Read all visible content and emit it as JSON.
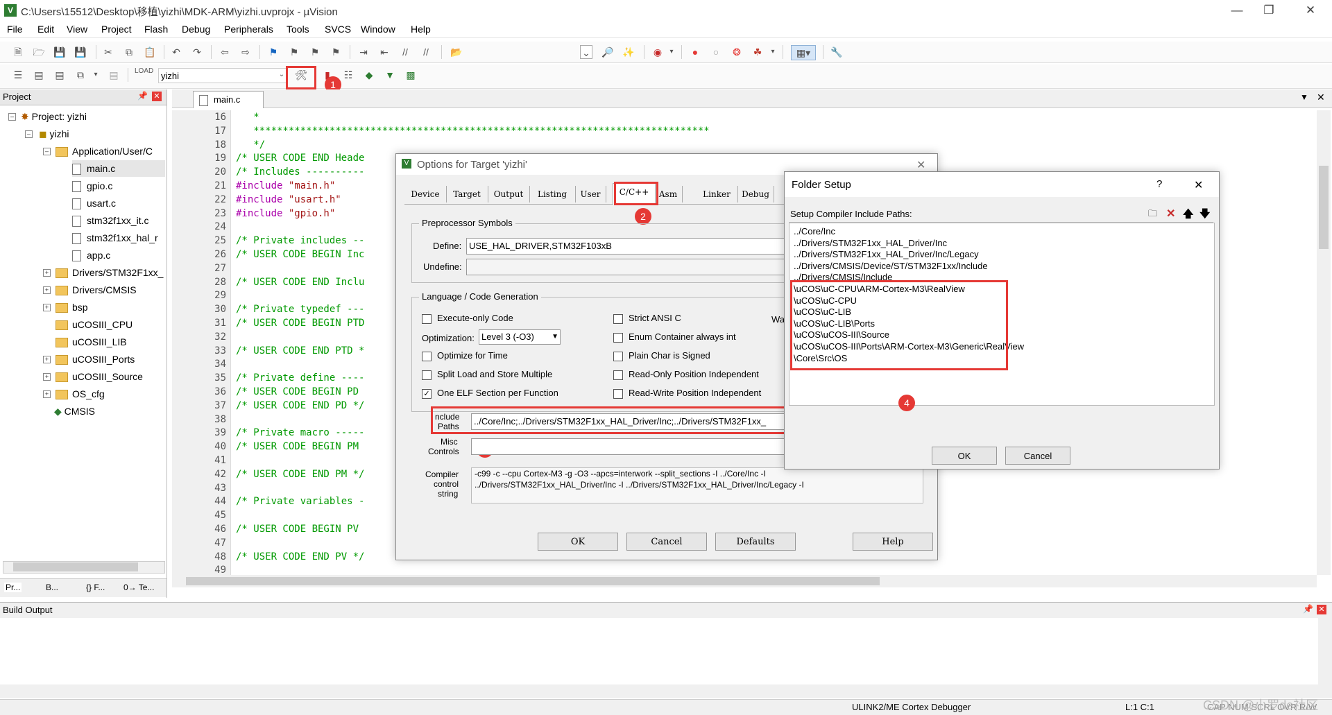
{
  "window": {
    "title": "C:\\Users\\15512\\Desktop\\移植\\yizhi\\MDK-ARM\\yizhi.uvprojx - µVision"
  },
  "menu": [
    "File",
    "Edit",
    "View",
    "Project",
    "Flash",
    "Debug",
    "Peripherals",
    "Tools",
    "SVCS",
    "Window",
    "Help"
  ],
  "toolbar2": {
    "target_select": "yizhi"
  },
  "badges": [
    "1",
    "2",
    "3",
    "4"
  ],
  "project": {
    "header": "Project",
    "root": "Project: yizhi",
    "target": "yizhi",
    "group_app": "Application/User/C",
    "files": [
      "main.c",
      "gpio.c",
      "usart.c",
      "stm32f1xx_it.c",
      "stm32f1xx_hal_r",
      "app.c"
    ],
    "groups": [
      "Drivers/STM32F1xx_",
      "Drivers/CMSIS",
      "bsp",
      "uCOSIII_CPU",
      "uCOSIII_LIB",
      "uCOSIII_Ports",
      "uCOSIII_Source",
      "OS_cfg"
    ],
    "cmsis": "CMSIS",
    "bottom_tabs": [
      "Pr...",
      "B...",
      "{} F...",
      "0→ Te..."
    ]
  },
  "editor": {
    "tab": "main.c",
    "line_numbers": [
      "16",
      "17",
      "18",
      "19",
      "20",
      "21",
      "22",
      "23",
      "24",
      "25",
      "26",
      "27",
      "28",
      "29",
      "30",
      "31",
      "32",
      "33",
      "34",
      "35",
      "36",
      "37",
      "38",
      "39",
      "40",
      "41",
      "42",
      "43",
      "44",
      "45",
      "46",
      "47",
      "48",
      "49"
    ],
    "lines": [
      "   *",
      "   ******************************************************************************",
      "   */",
      "/* USER CODE END Heade",
      "/* Includes ----------",
      "#include \"main.h\"",
      "#include \"usart.h\"",
      "#include \"gpio.h\"",
      "",
      "/* Private includes --",
      "/* USER CODE BEGIN Inc",
      "",
      "/* USER CODE END Inclu",
      "",
      "/* Private typedef ---",
      "/* USER CODE BEGIN PTD",
      "",
      "/* USER CODE END PTD *",
      "",
      "/* Private define ----",
      "/* USER CODE BEGIN PD",
      "/* USER CODE END PD */",
      "",
      "/* Private macro -----",
      "/* USER CODE BEGIN PM",
      "",
      "/* USER CODE END PM */",
      "",
      "/* Private variables -",
      "",
      "/* USER CODE BEGIN PV",
      "",
      "/* USER CODE END PV */",
      ""
    ]
  },
  "options_dialog": {
    "title": "Options for Target 'yizhi'",
    "tabs": [
      "Device",
      "Target",
      "Output",
      "Listing",
      "User",
      "C/C++",
      "Asm",
      "Linker",
      "Debug"
    ],
    "preproc_group": "Preprocessor Symbols",
    "define_label": "Define:",
    "define_value": "USE_HAL_DRIVER,STM32F103xB",
    "undefine_label": "Undefine:",
    "lang_group": "Language / Code Generation",
    "execute_only": "Execute-only Code",
    "optimization_label": "Optimization:",
    "optimization_value": "Level 3 (-O3)",
    "optimize_time": "Optimize for Time",
    "split_load": "Split Load and Store Multiple",
    "one_elf": "One ELF Section per Function",
    "strict_ansi": "Strict ANSI C",
    "enum_container": "Enum Container always int",
    "plain_char": "Plain Char is Signed",
    "ro_pos": "Read-Only Position Independent",
    "rw_pos": "Read-Write Position Independent",
    "wa_clip": "Wa",
    "include_label_1": "nclude",
    "include_label_2": "Paths",
    "include_value": "../Core/Inc;../Drivers/STM32F1xx_HAL_Driver/Inc;../Drivers/STM32F1xx_",
    "misc_label_1": "Misc",
    "misc_label_2": "Controls",
    "compiler_label_1": "Compiler",
    "compiler_label_2": "control",
    "compiler_label_3": "string",
    "compiler_line_1": "-c99 -c --cpu Cortex-M3 -g -O3 --apcs=interwork --split_sections -I ../Core/Inc -I",
    "compiler_line_2": "../Drivers/STM32F1xx_HAL_Driver/Inc -I ../Drivers/STM32F1xx_HAL_Driver/Inc/Legacy -I",
    "ok": "OK",
    "cancel": "Cancel",
    "defaults": "Defaults",
    "help": "Help"
  },
  "folder_dialog": {
    "title": "Folder Setup",
    "help_glyph": "?",
    "close_glyph": "✕",
    "subtitle": "Setup Compiler Include Paths:",
    "paths": [
      "../Core/Inc",
      "../Drivers/STM32F1xx_HAL_Driver/Inc",
      "../Drivers/STM32F1xx_HAL_Driver/Inc/Legacy",
      "../Drivers/CMSIS/Device/ST/STM32F1xx/Include",
      "../Drivers/CMSIS/Include",
      "\\uCOS\\uC-CPU\\ARM-Cortex-M3\\RealView",
      "\\uCOS\\uC-CPU",
      "\\uCOS\\uC-LIB",
      "\\uCOS\\uC-LIB\\Ports",
      "\\uCOS\\uCOS-III\\Source",
      "\\uCOS\\uCOS-III\\Ports\\ARM-Cortex-M3\\Generic\\RealView",
      "\\Core\\Src\\OS"
    ],
    "ok": "OK",
    "cancel": "Cancel"
  },
  "build": {
    "header": "Build Output"
  },
  "status": {
    "debugger": "ULINK2/ME Cortex Debugger",
    "position": "L:1 C:1",
    "flags": "CAP  NUM  SCRL  OVR  R/W"
  },
  "watermark": "CSDN @小罗de社区",
  "colors": {
    "highlight_red": "#e53935",
    "comment_green": "#009900",
    "preproc_purple": "#aa00aa",
    "string_red": "#a31515"
  }
}
